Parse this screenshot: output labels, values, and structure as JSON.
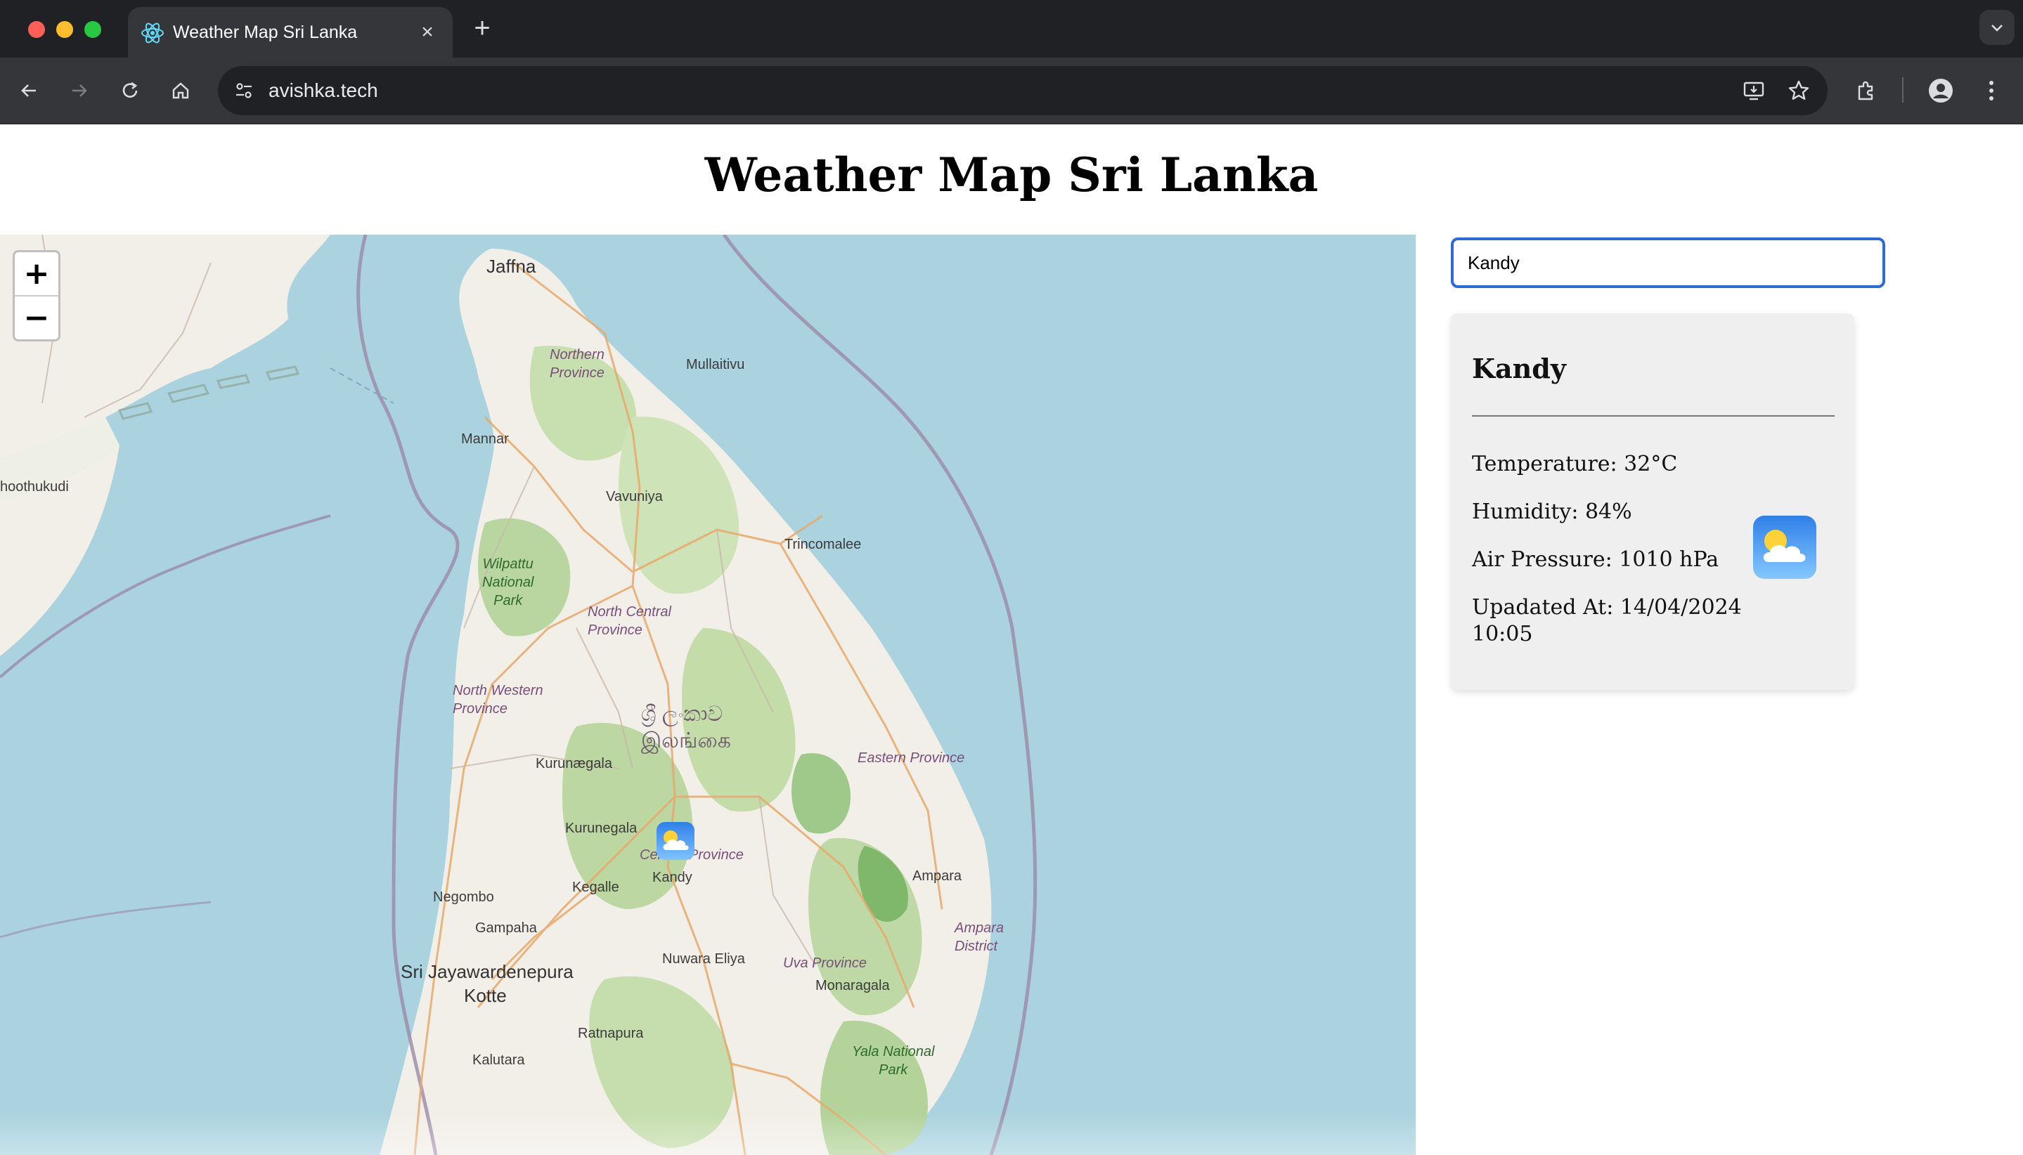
{
  "browser": {
    "tab_title": "Weather Map Sri Lanka",
    "url": "avishka.tech"
  },
  "page": {
    "title": "Weather Map Sri Lanka"
  },
  "search": {
    "value": "Kandy"
  },
  "weather_card": {
    "city": "Kandy",
    "temperature": "Temperature: 32°C",
    "humidity": "Humidity: 84%",
    "pressure": "Air Pressure: 1010 hPa",
    "updated_line1": "Upadated At: 14/04/2024",
    "updated_line2": "10:05",
    "icon": "partly-cloudy-icon"
  },
  "map": {
    "zoom_in": "+",
    "zoom_out": "−",
    "labels": {
      "jaffna": "Jaffna",
      "mullaitivu": "Mullaitivu",
      "mannar": "Mannar",
      "vavuniya": "Vavuniya",
      "trincomalee": "Trincomalee",
      "thoothukudi": "hoothukudi",
      "northern_1": "Northern",
      "northern_2": "Province",
      "wilpattu_1": "Wilpattu",
      "wilpattu_2": "National",
      "wilpattu_3": "Park",
      "north_central_1": "North Central",
      "north_central_2": "Province",
      "north_western_1": "North Western",
      "north_western_2": "Province",
      "sinhala": "ශ්‍රී ලංකාව",
      "tamil": "இலங்கை",
      "kurunegala_small": "Kurunægala",
      "kurunegala": "Kurunegala",
      "eastern": "Eastern Province",
      "central": "Central Province",
      "kandy": "Kandy",
      "kegalle": "Kegalle",
      "negombo": "Negombo",
      "gampaha": "Gampaha",
      "ampara": "Ampara",
      "ampara_district_1": "Ampara",
      "ampara_district_2": "District",
      "sjk_1": "Sri Jayawardenepura",
      "sjk_2": "Kotte",
      "nuwara_eliya": "Nuwara Eliya",
      "uva": "Uva Province",
      "monaragala": "Monaragala",
      "ratnapura": "Ratnapura",
      "kalutara": "Kalutara",
      "yala_1": "Yala National",
      "yala_2": "Park"
    }
  }
}
